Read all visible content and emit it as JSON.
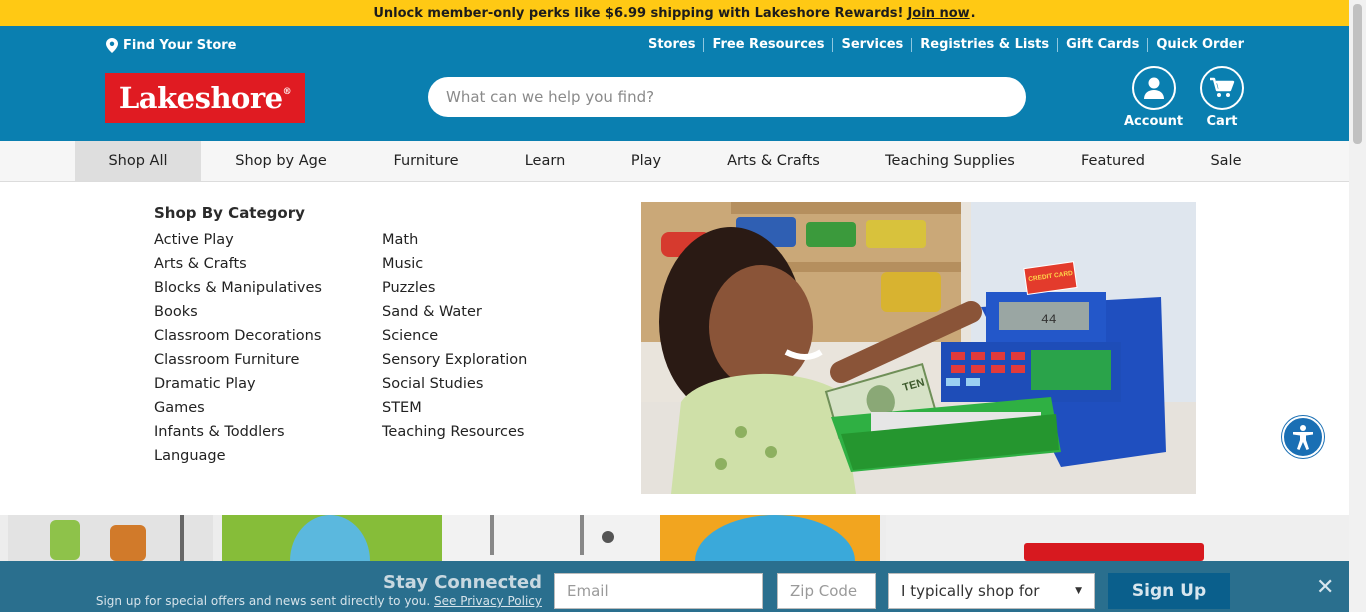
{
  "promo": {
    "text": "Unlock member-only perks like $6.99 shipping with Lakeshore Rewards!",
    "link": "Join now",
    "end": "."
  },
  "header": {
    "find_store": "Find Your Store",
    "utility_links": [
      "Stores",
      "Free Resources",
      "Services",
      "Registries & Lists",
      "Gift Cards",
      "Quick Order"
    ],
    "logo": "Lakeshore",
    "search_placeholder": "What can we help you find?",
    "account": "Account",
    "cart": "Cart",
    "colors": {
      "header_bg": "#0a7fb0",
      "promo_bg": "#ffc914",
      "logo_bg": "#e01b22"
    }
  },
  "nav": {
    "items": [
      "Shop All",
      "Shop by Age",
      "Furniture",
      "Learn",
      "Play",
      "Arts & Crafts",
      "Teaching Supplies",
      "Featured",
      "Sale"
    ],
    "active": "Shop All"
  },
  "mega": {
    "heading": "Shop By Category",
    "col1": [
      "Active Play",
      "Arts & Crafts",
      "Blocks & Manipulatives",
      "Books",
      "Classroom Decorations",
      "Classroom Furniture",
      "Dramatic Play",
      "Games",
      "Infants & Toddlers",
      "Language"
    ],
    "col2": [
      "Math",
      "Music",
      "Puzzles",
      "Sand & Water",
      "Science",
      "Sensory Exploration",
      "Social Studies",
      "STEM",
      "Teaching Resources"
    ],
    "image": {
      "card_text": "CREDIT CARD",
      "display_value": "44",
      "bill_text": "TEN"
    }
  },
  "newsletter": {
    "title": "Stay Connected",
    "subtitle": "Sign up for special offers and news sent directly to you.",
    "privacy_link": "See Privacy Policy",
    "email_placeholder": "Email",
    "zip_placeholder": "Zip Code",
    "shop_for": "I typically shop for",
    "signup": "Sign Up"
  }
}
